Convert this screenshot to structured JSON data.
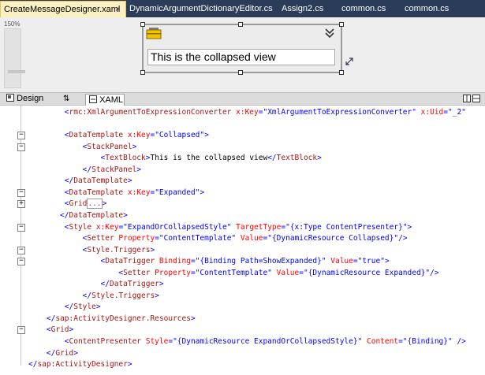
{
  "tabs": [
    {
      "label": "CreateMessageDesigner.xaml",
      "active": true
    },
    {
      "label": "DynamicArgumentDictionaryEditor.cs",
      "active": false
    },
    {
      "label": "Assign2.cs",
      "active": false
    },
    {
      "label": "common.cs",
      "active": false
    },
    {
      "label": "common.cs",
      "active": false
    }
  ],
  "tab_close": "×",
  "designer": {
    "zoom_label": "150%",
    "collapsed_view_text": "This is the collapsed view"
  },
  "view_tabs": {
    "design": "Design",
    "swap": "⇅",
    "xaml": "XAML"
  },
  "colors": {
    "tabbar": "#2b3c59",
    "active_tab": "#fbf0c4",
    "bracket": "#0000ff",
    "element": "#a31515",
    "attribute": "#ff0000"
  },
  "code_lines": [
    [
      [
        "        ",
        "tx"
      ],
      [
        "<",
        "br"
      ],
      [
        "rmc:XmlArgumentToExpressionConverter",
        "el"
      ],
      [
        " x:Key",
        "at"
      ],
      [
        "=",
        "br"
      ],
      [
        "\"XmlArgumentToExpressionConverter\"",
        "val"
      ],
      [
        " x:Uid",
        "at"
      ],
      [
        "=",
        "br"
      ],
      [
        "\"_2\"",
        "val"
      ]
    ],
    [
      [
        "",
        "tx"
      ]
    ],
    [
      [
        "        ",
        "tx"
      ],
      [
        "<",
        "br"
      ],
      [
        "DataTemplate",
        "el"
      ],
      [
        " x:Key",
        "at"
      ],
      [
        "=",
        "br"
      ],
      [
        "\"Collapsed\"",
        "val"
      ],
      [
        ">",
        "br"
      ]
    ],
    [
      [
        "            ",
        "tx"
      ],
      [
        "<",
        "br"
      ],
      [
        "StackPanel",
        "el"
      ],
      [
        ">",
        "br"
      ]
    ],
    [
      [
        "                ",
        "tx"
      ],
      [
        "<",
        "br"
      ],
      [
        "TextBlock",
        "el"
      ],
      [
        ">",
        "br"
      ],
      [
        "This is the collapsed view",
        "tx"
      ],
      [
        "</",
        "br"
      ],
      [
        "TextBlock",
        "el"
      ],
      [
        ">",
        "br"
      ]
    ],
    [
      [
        "            ",
        "tx"
      ],
      [
        "</",
        "br"
      ],
      [
        "StackPanel",
        "el"
      ],
      [
        ">",
        "br"
      ]
    ],
    [
      [
        "        ",
        "tx"
      ],
      [
        "</",
        "br"
      ],
      [
        "DataTemplate",
        "el"
      ],
      [
        ">",
        "br"
      ]
    ],
    [
      [
        "        ",
        "tx"
      ],
      [
        "<",
        "br"
      ],
      [
        "DataTemplate",
        "el"
      ],
      [
        " x:Key",
        "at"
      ],
      [
        "=",
        "br"
      ],
      [
        "\"Expanded\"",
        "val"
      ],
      [
        ">",
        "br"
      ]
    ],
    [
      [
        "        ",
        "tx"
      ],
      [
        "<",
        "br"
      ],
      [
        "Grid",
        "el"
      ],
      [
        "...",
        "box"
      ],
      [
        ">",
        "br"
      ]
    ],
    [
      [
        "       ",
        "tx"
      ],
      [
        "</",
        "br"
      ],
      [
        "DataTemplate",
        "el"
      ],
      [
        ">",
        "br"
      ]
    ],
    [
      [
        "        ",
        "tx"
      ],
      [
        "<",
        "br"
      ],
      [
        "Style",
        "el"
      ],
      [
        " x:Key",
        "at"
      ],
      [
        "=",
        "br"
      ],
      [
        "\"ExpandOrCollapsedStyle\"",
        "val"
      ],
      [
        " TargetType",
        "at"
      ],
      [
        "=",
        "br"
      ],
      [
        "\"{x:Type ContentPresenter}\"",
        "val"
      ],
      [
        ">",
        "br"
      ]
    ],
    [
      [
        "            ",
        "tx"
      ],
      [
        "<",
        "br"
      ],
      [
        "Setter",
        "el"
      ],
      [
        " Property",
        "at"
      ],
      [
        "=",
        "br"
      ],
      [
        "\"ContentTemplate\"",
        "val"
      ],
      [
        " Value",
        "at"
      ],
      [
        "=",
        "br"
      ],
      [
        "\"{DynamicResource Collapsed}\"",
        "val"
      ],
      [
        "/>",
        "br"
      ]
    ],
    [
      [
        "            ",
        "tx"
      ],
      [
        "<",
        "br"
      ],
      [
        "Style.Triggers",
        "el"
      ],
      [
        ">",
        "br"
      ]
    ],
    [
      [
        "                ",
        "tx"
      ],
      [
        "<",
        "br"
      ],
      [
        "DataTrigger",
        "el"
      ],
      [
        " Binding",
        "at"
      ],
      [
        "=",
        "br"
      ],
      [
        "\"{Binding Path=ShowExpanded}\"",
        "val"
      ],
      [
        " Value",
        "at"
      ],
      [
        "=",
        "br"
      ],
      [
        "\"true\"",
        "val"
      ],
      [
        ">",
        "br"
      ]
    ],
    [
      [
        "                    ",
        "tx"
      ],
      [
        "<",
        "br"
      ],
      [
        "Setter",
        "el"
      ],
      [
        " Property",
        "at"
      ],
      [
        "=",
        "br"
      ],
      [
        "\"ContentTemplate\"",
        "val"
      ],
      [
        " Value",
        "at"
      ],
      [
        "=",
        "br"
      ],
      [
        "\"{DynamicResource Expanded}\"",
        "val"
      ],
      [
        "/>",
        "br"
      ]
    ],
    [
      [
        "                ",
        "tx"
      ],
      [
        "</",
        "br"
      ],
      [
        "DataTrigger",
        "el"
      ],
      [
        ">",
        "br"
      ]
    ],
    [
      [
        "            ",
        "tx"
      ],
      [
        "</",
        "br"
      ],
      [
        "Style.Triggers",
        "el"
      ],
      [
        ">",
        "br"
      ]
    ],
    [
      [
        "        ",
        "tx"
      ],
      [
        "</",
        "br"
      ],
      [
        "Style",
        "el"
      ],
      [
        ">",
        "br"
      ]
    ],
    [
      [
        "    ",
        "tx"
      ],
      [
        "</",
        "br"
      ],
      [
        "sap:ActivityDesigner.Resources",
        "el"
      ],
      [
        ">",
        "br"
      ]
    ],
    [
      [
        "    ",
        "tx"
      ],
      [
        "<",
        "br"
      ],
      [
        "Grid",
        "el"
      ],
      [
        ">",
        "br"
      ]
    ],
    [
      [
        "        ",
        "tx"
      ],
      [
        "<",
        "br"
      ],
      [
        "ContentPresenter",
        "el"
      ],
      [
        " Style",
        "at"
      ],
      [
        "=",
        "br"
      ],
      [
        "\"{DynamicResource ExpandOrCollapsedStyle}\"",
        "val"
      ],
      [
        " Content",
        "at"
      ],
      [
        "=",
        "br"
      ],
      [
        "\"{Binding}\"",
        "val"
      ],
      [
        " />",
        "br"
      ]
    ],
    [
      [
        "    ",
        "tx"
      ],
      [
        "</",
        "br"
      ],
      [
        "Grid",
        "el"
      ],
      [
        ">",
        "br"
      ]
    ],
    [
      [
        "",
        "tx"
      ],
      [
        "</",
        "br"
      ],
      [
        "sap:ActivityDesigner",
        "el"
      ],
      [
        ">",
        "br"
      ]
    ]
  ],
  "fold_markers": [
    {
      "line": 2,
      "glyph": "−"
    },
    {
      "line": 3,
      "glyph": "−"
    },
    {
      "line": 7,
      "glyph": "−"
    },
    {
      "line": 8,
      "glyph": "+"
    },
    {
      "line": 10,
      "glyph": "−"
    },
    {
      "line": 12,
      "glyph": "−"
    },
    {
      "line": 13,
      "glyph": "−"
    },
    {
      "line": 19,
      "glyph": "−"
    }
  ]
}
